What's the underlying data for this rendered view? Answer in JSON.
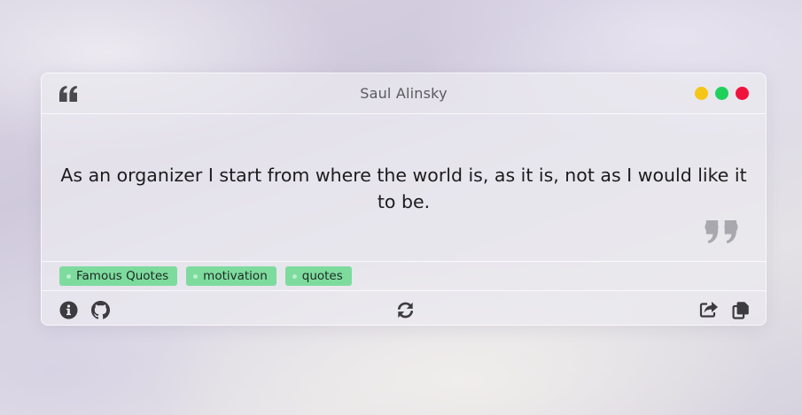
{
  "window": {
    "title": "Saul Alinsky",
    "controls": [
      {
        "name": "minimize",
        "color": "#f5c518"
      },
      {
        "name": "maximize",
        "color": "#1fd15c"
      },
      {
        "name": "close",
        "color": "#f0133e"
      }
    ]
  },
  "quote": {
    "text": "As an organizer I start from where the world is, as it is, not as I would like it to be."
  },
  "tags": [
    {
      "label": "Famous Quotes"
    },
    {
      "label": "motivation"
    },
    {
      "label": "quotes"
    }
  ],
  "icons": {
    "open_quote": "quote-left-icon",
    "close_quote": "quote-right-icon",
    "info": "info-icon",
    "github": "github-icon",
    "refresh": "refresh-icon",
    "share": "share-icon",
    "copy": "copy-icon"
  },
  "colors": {
    "tag_background": "#7ddb9e",
    "icon": "#3c3c40",
    "title_text": "#5a5a5e"
  }
}
